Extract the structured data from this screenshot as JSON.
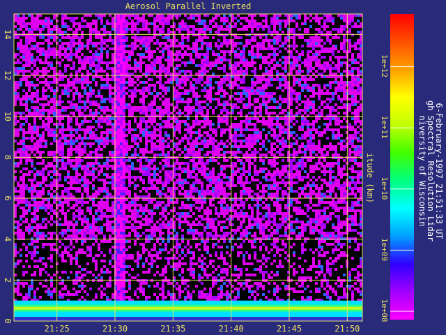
{
  "chart_data": {
    "type": "heatmap",
    "title": "Aerosol Parallel Inverted",
    "ylabel": "itude (km)",
    "x_ticks": [
      "21:25",
      "21:30",
      "21:35",
      "21:40",
      "21:45",
      "21:50"
    ],
    "x_tick_minutes": [
      25,
      30,
      35,
      40,
      45,
      50
    ],
    "xlim_minutes_after_2100_UT": [
      21.3,
      51.3
    ],
    "y_ticks": [
      "0",
      "2",
      "4",
      "6",
      "8",
      "10",
      "12",
      "14"
    ],
    "ylim": [
      0,
      15
    ],
    "grid": true,
    "colorbar": {
      "labels": [
        "1e+08",
        "1e+09",
        "1e+10",
        "1e+11",
        "1e+12"
      ],
      "scale": "log",
      "range": [
        100000000.0,
        10000000000000.0
      ],
      "colors": [
        "#ff00ff",
        "#a000ff",
        "#3000ff",
        "#00a0ff",
        "#00ffff",
        "#00ff80",
        "#40ff00",
        "#c0ff00",
        "#ffff00",
        "#ffa000",
        "#ff5000",
        "#ff0000"
      ]
    },
    "side_text": [
      "niversity of Wisconsin",
      "gh Spectral Resolution Lidar",
      "6-February-1997 21:51:33 UT"
    ],
    "feature_notes": "bright aerosol layer near 0.6 km; dense vertical streak near 21:30"
  }
}
